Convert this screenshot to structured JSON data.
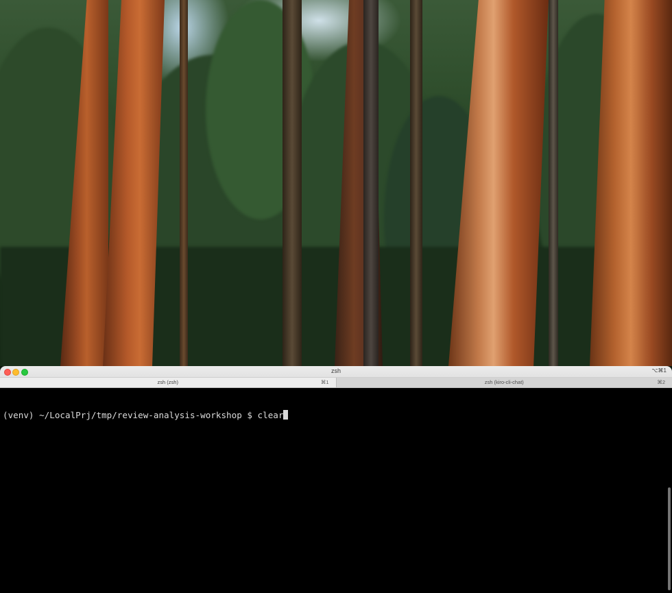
{
  "desktop": {
    "wallpaper_name": "forest-wallpaper"
  },
  "window": {
    "title": "zsh",
    "title_shortcut": "⌥⌘1",
    "tabs": [
      {
        "label": "zsh (zsh)",
        "shortcut": "⌘1",
        "active": true
      },
      {
        "label": "zsh (kiro-cli-chat)",
        "shortcut": "⌘2",
        "active": false
      }
    ]
  },
  "terminal": {
    "prompt": "(venv) ~/LocalPrj/tmp/review-analysis-workshop $ ",
    "command": "clear",
    "colors": {
      "background": "#000000",
      "foreground": "#dcdcdc",
      "cursor": "#d8d8d8"
    }
  }
}
